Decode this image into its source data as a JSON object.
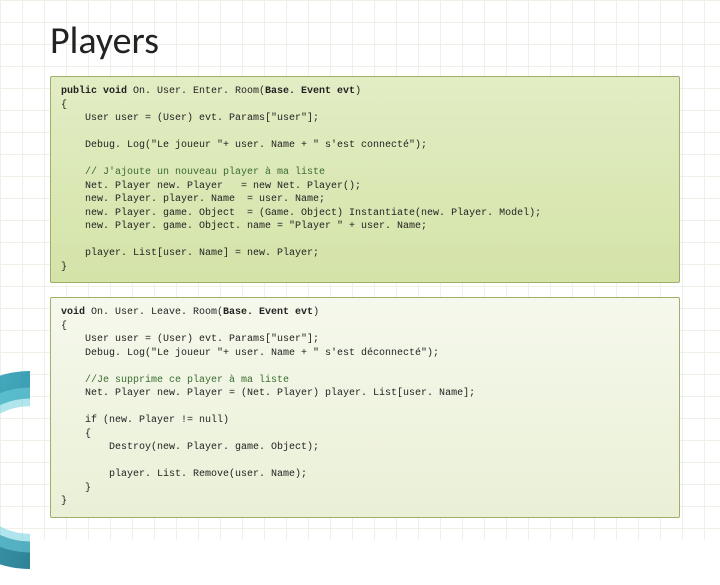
{
  "title": "Players",
  "box1": {
    "sig_pre": "public void",
    "sig_mid": " On. User. Enter. Room(",
    "sig_bold": "Base. Event evt",
    "sig_post": ")",
    "open": "{",
    "l1": "    User user = (User) evt. Params[\"user\"];",
    "l2": "    Debug. Log(\"Le joueur \"+ user. Name + \" s'est connecté\");",
    "cmt": "    // J'ajoute un nouveau player à ma liste",
    "l3": "    Net. Player new. Player   = new Net. Player();",
    "l4": "    new. Player. player. Name  = user. Name;",
    "l5": "    new. Player. game. Object  = (Game. Object) Instantiate(new. Player. Model);",
    "l6": "    new. Player. game. Object. name = \"Player \" + user. Name;",
    "l7": "    player. List[user. Name] = new. Player;",
    "close": "}"
  },
  "box2": {
    "sig_pre": "void",
    "sig_mid": " On. User. Leave. Room(",
    "sig_bold": "Base. Event evt",
    "sig_post": ")",
    "open": "{",
    "l1": "    User user = (User) evt. Params[\"user\"];",
    "l2": "    Debug. Log(\"Le joueur \"+ user. Name + \" s'est déconnecté\");",
    "cmt": "    //Je supprime ce player à ma liste",
    "l3": "    Net. Player new. Player = (Net. Player) player. List[user. Name];",
    "l4": "    if (new. Player != null)",
    "l5": "    {",
    "l6": "        Destroy(new. Player. game. Object);",
    "l7": "        player. List. Remove(user. Name);",
    "l8": "    }",
    "close": "}"
  }
}
